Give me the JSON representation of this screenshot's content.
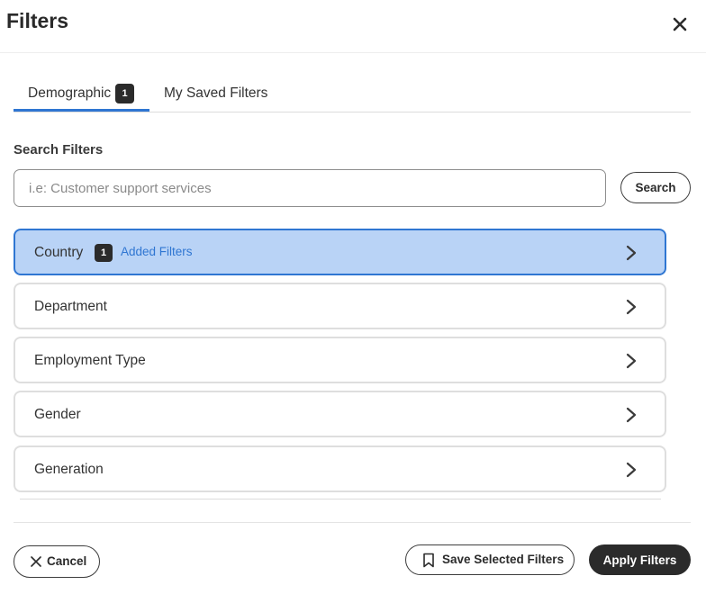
{
  "header": {
    "title": "Filters",
    "close_icon": "close-icon"
  },
  "tabs": [
    {
      "label": "Demographic",
      "count": "1",
      "active": true
    },
    {
      "label": "My Saved Filters",
      "active": false
    }
  ],
  "search": {
    "section_label": "Search Filters",
    "placeholder": "i.e: Customer support services",
    "value": "",
    "button_label": "Search"
  },
  "filters": [
    {
      "name": "Country",
      "count": "1",
      "added_label": "Added Filters",
      "active": true,
      "icon": "chevron-right-icon"
    },
    {
      "name": "Department",
      "icon": "chevron-right-icon"
    },
    {
      "name": "Employment Type",
      "icon": "chevron-right-icon"
    },
    {
      "name": "Gender",
      "icon": "chevron-right-icon"
    },
    {
      "name": "Generation",
      "icon": "chevron-right-icon"
    }
  ],
  "footer": {
    "cancel_label": "Cancel",
    "cancel_icon": "close-icon",
    "save_label": "Save Selected Filters",
    "save_icon": "bookmark-icon",
    "apply_label": "Apply Filters"
  },
  "colors": {
    "accent": "#2f76d2",
    "active_row_bg": "#b9d3f6",
    "dark": "#2b2b2b"
  }
}
